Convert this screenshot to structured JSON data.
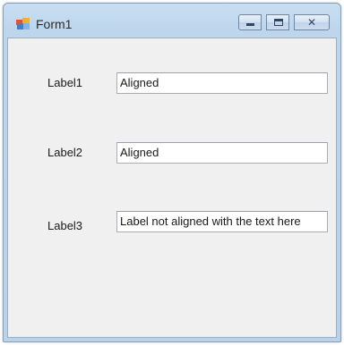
{
  "window": {
    "title": "Form1"
  },
  "title_bar": {
    "icon": "app-form-icon",
    "buttons": {
      "minimize": "minimize-icon",
      "maximize": "maximize-icon",
      "close": "close-icon"
    },
    "close_glyph": "✕"
  },
  "form": {
    "rows": [
      {
        "label": "Label1",
        "textbox_value": "Aligned"
      },
      {
        "label": "Label2",
        "textbox_value": "Aligned"
      },
      {
        "label": "Label3",
        "textbox_value": "Label not aligned with the text here"
      }
    ]
  },
  "colors": {
    "client_background": "#f0f0f0",
    "frame": "#bed6ec",
    "textbox_border": "#abadb3"
  }
}
